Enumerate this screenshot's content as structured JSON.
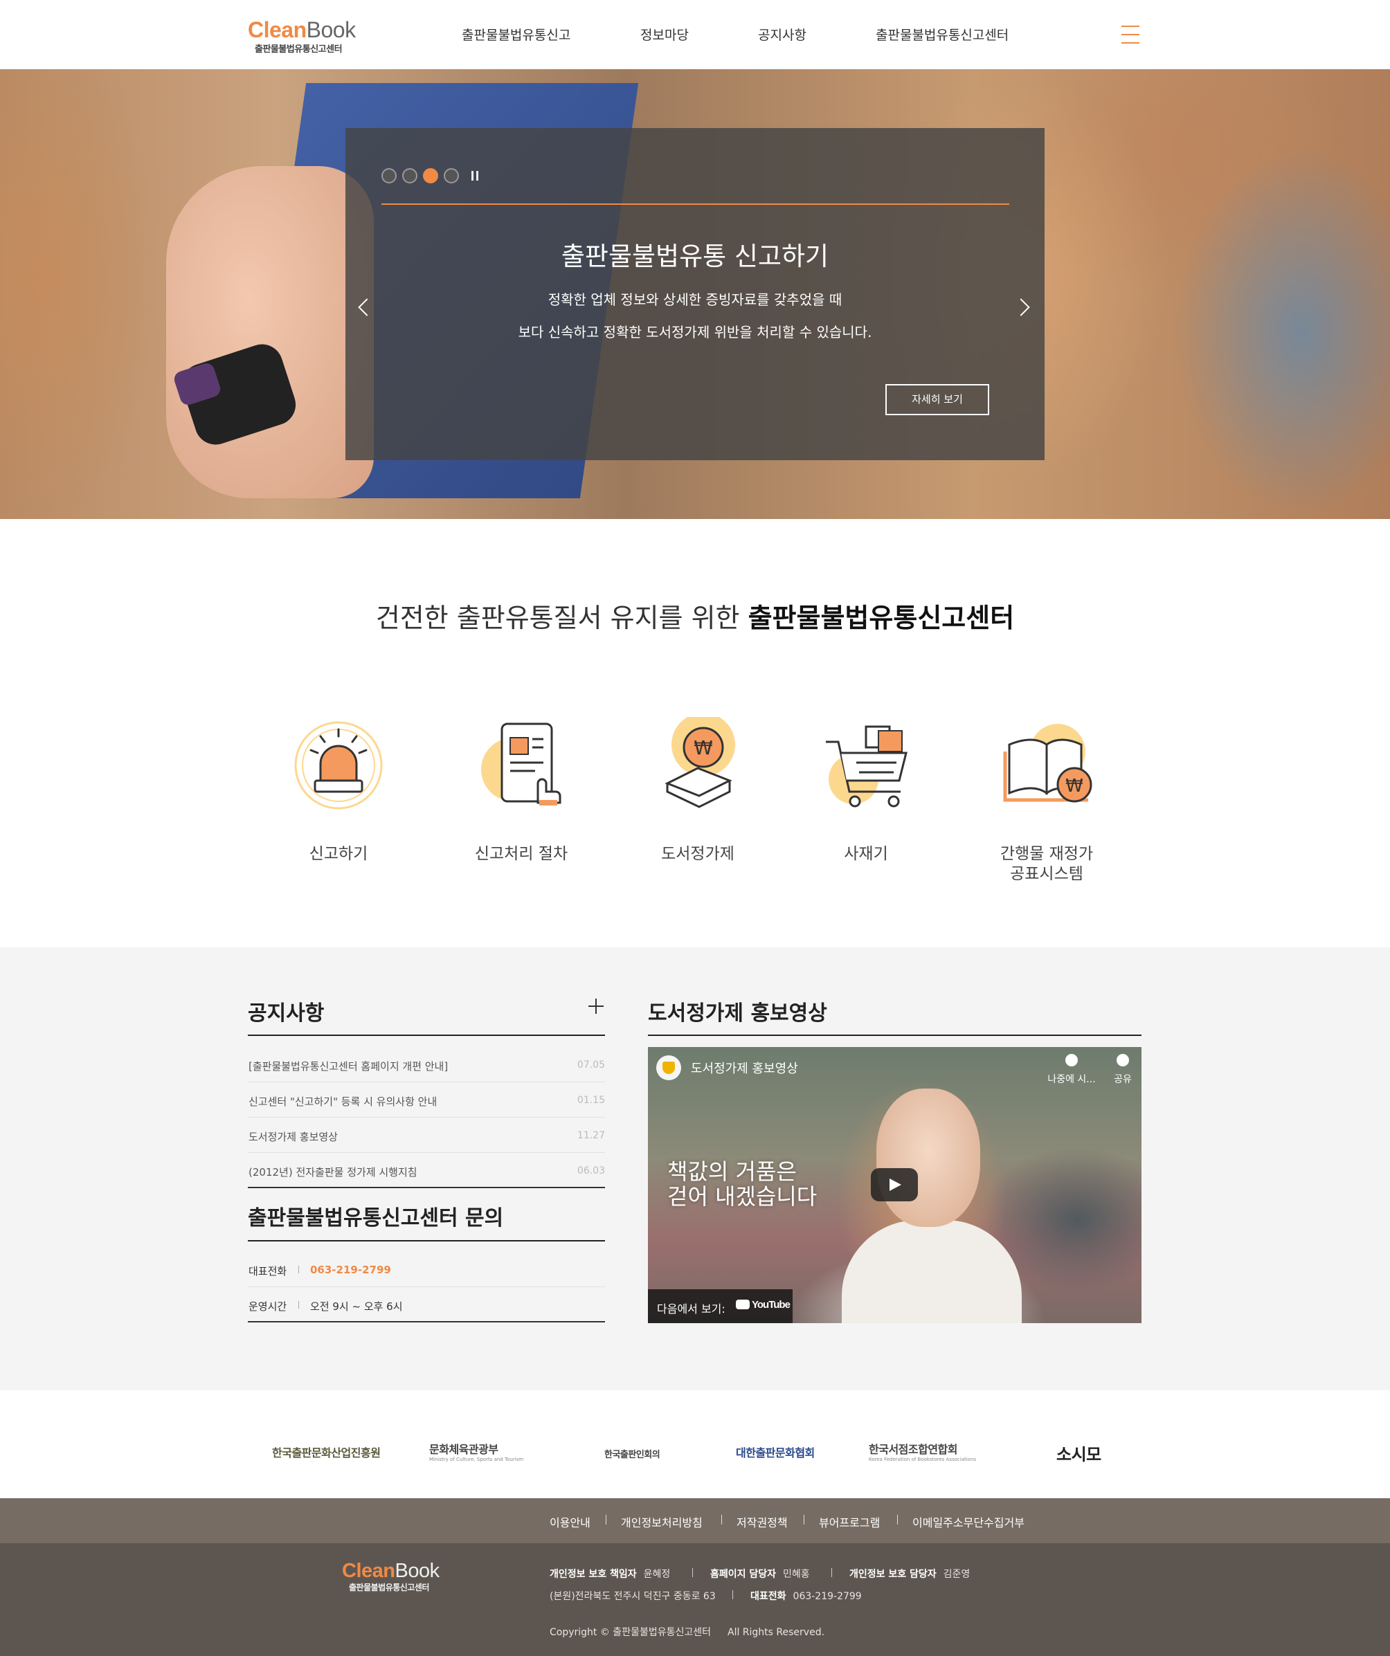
{
  "header": {
    "logo": {
      "part1": "Clean",
      "part2": "Book",
      "sub": "출판물불법유통신고센터"
    },
    "nav": [
      "출판물불법유통신고",
      "정보마당",
      "공지사항",
      "출판물불법유통신고센터"
    ]
  },
  "hero": {
    "slides_total": 4,
    "active_slide": 3,
    "title": "출판물불법유통 신고하기",
    "text_line1": "정확한 업체 정보와 상세한 증빙자료를 갖추었을 때",
    "text_line2": "보다 신속하고 정확한 도서정가제 위반을 처리할 수 있습니다.",
    "more_button": "자세히 보기"
  },
  "intro": {
    "normal": "건전한 출판유통질서 유지를 위한 ",
    "bold": "출판물불법유통신고센터"
  },
  "services": [
    {
      "label": "신고하기",
      "icon": "siren-icon"
    },
    {
      "label": "신고처리 절차",
      "icon": "tablet-touch-icon"
    },
    {
      "label": "도서정가제",
      "icon": "book-won-icon"
    },
    {
      "label": "사재기",
      "icon": "cart-icon"
    },
    {
      "label_line1": "간행물 재정가",
      "label_line2": "공표시스템",
      "icon": "open-book-won-icon"
    }
  ],
  "notice": {
    "title": "공지사항",
    "items": [
      {
        "title": "[출판물불법유통신고센터 홈페이지 개편 안내]",
        "date": "07.05"
      },
      {
        "title": "신고센터 \"신고하기\" 등록 시 유의사항 안내",
        "date": "01.15"
      },
      {
        "title": "도서정가제 홍보영상",
        "date": "11.27"
      },
      {
        "title": "(2012년) 전자출판물 정가제 시행지침",
        "date": "06.03"
      }
    ]
  },
  "contact": {
    "title": "출판물불법유통신고센터 문의",
    "phone_label": "대표전화",
    "phone": "063-219-2799",
    "hours_label": "운영시간",
    "hours": "오전 9시 ~ 오후 6시"
  },
  "video": {
    "section_title": "도서정가제 홍보영상",
    "video_title": "도서정가제 홍보영상",
    "watch_later": "나중에 시...",
    "share": "공유",
    "overlay_line1": "책값의 거품은",
    "overlay_line2": "걷어 내겠습니다",
    "watch_on": "다음에서 보기:",
    "youtube": "YouTube"
  },
  "partners": [
    {
      "name": "한국출판문화산업진흥원"
    },
    {
      "name": "문화체육관광부",
      "sub": "Ministry of Culture, Sports and Tourism"
    },
    {
      "name": "한국출판인회의"
    },
    {
      "name": "대한출판문화협회"
    },
    {
      "name": "한국서점조합연합회",
      "sub": "Korea Federation of Bookstores Associations"
    },
    {
      "name": "소시모"
    }
  ],
  "footer": {
    "links": [
      "이용안내",
      "개인정보처리방침",
      "저작권정책",
      "뷰어프로그램",
      "이메일주소무단수집거부"
    ],
    "privacy_officer_label": "개인정보 보호 책임자",
    "privacy_officer": "윤혜정",
    "homepage_manager_label": "홈페이지 담당자",
    "homepage_manager": "민혜홍",
    "privacy_manager_label": "개인정보 보호 담당자",
    "privacy_manager": "김준영",
    "address": "(본원)전라북도 전주시 덕진구 중동로 63",
    "phone_label": "대표전화",
    "phone": "063-219-2799",
    "copyright": "Copyright © 출판물불법유통신고센터",
    "rights": "All Rights Reserved."
  },
  "colors": {
    "accent": "#f08a45",
    "footer_bar": "#766c63",
    "footer": "#5d5650",
    "section_bg": "#f4f4f4"
  }
}
